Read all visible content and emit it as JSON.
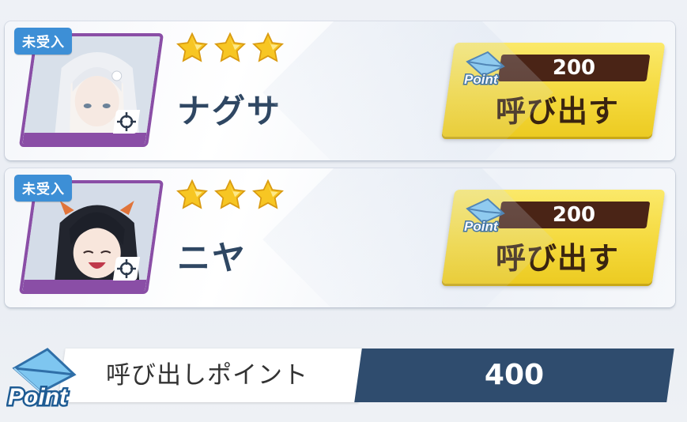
{
  "colors": {
    "badge": "#3d8fd6",
    "portrait_frame": "#8a4ea6",
    "button_yellow": "#f4d83a",
    "cost_bg": "#4a2416",
    "points_bg": "#2f4c6e",
    "name_text": "#2f4763"
  },
  "cards": [
    {
      "badge": "未受入",
      "stars": 3,
      "name": "ナグサ",
      "cost": "200",
      "button_label": "呼び出す",
      "point_icon_text": "Point"
    },
    {
      "badge": "未受入",
      "stars": 3,
      "name": "ニヤ",
      "cost": "200",
      "button_label": "呼び出す",
      "point_icon_text": "Point"
    }
  ],
  "footer": {
    "icon_text": "Point",
    "label": "呼び出しポイント",
    "value": "400"
  }
}
